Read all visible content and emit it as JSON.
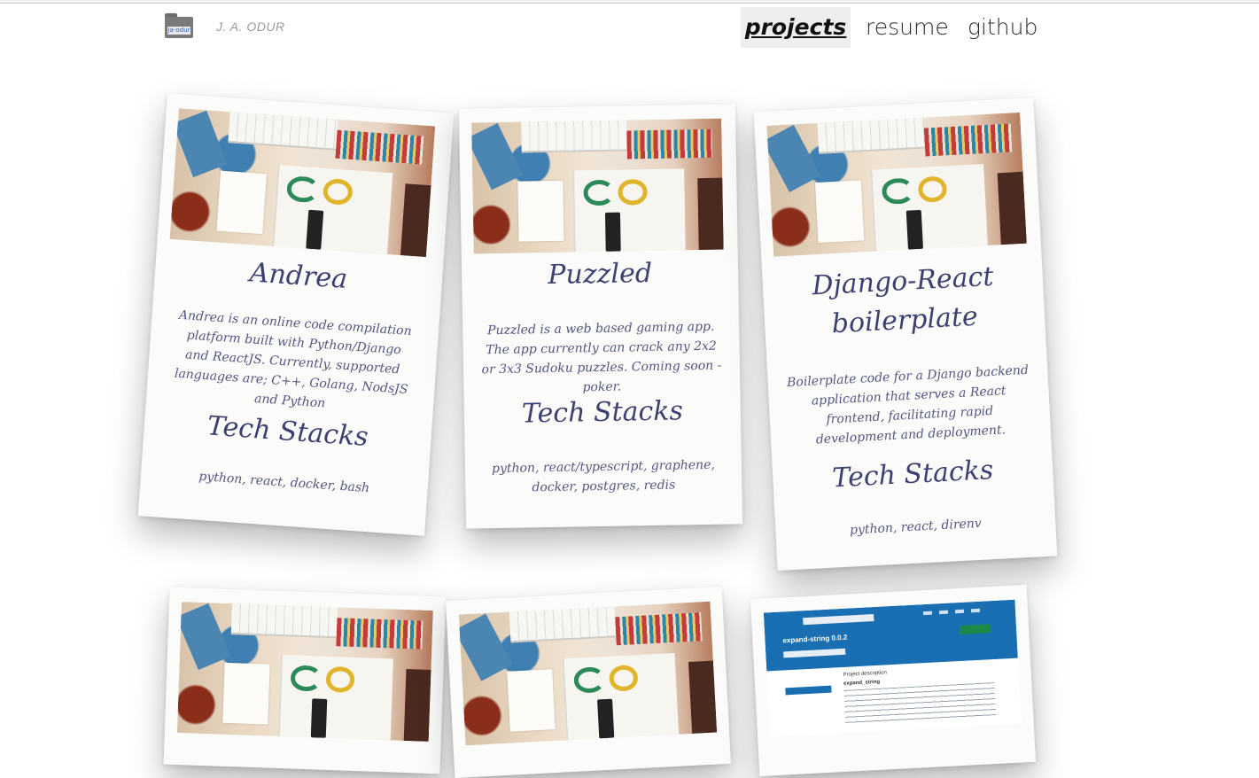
{
  "header": {
    "logo_label": "ja-odur",
    "brand": "J. A. ODUR",
    "nav": [
      {
        "label": "projects",
        "active": true
      },
      {
        "label": "resume",
        "active": false
      },
      {
        "label": "github",
        "active": false
      }
    ]
  },
  "cards": [
    {
      "title": "Andrea",
      "description": "Andrea is an online code compilation platform built with Python/Django and ReactJS. Currently, supported languages are; C++, Golang, NodsJS and Python",
      "tech_heading": "Tech Stacks",
      "stack": "python, react, docker, bash"
    },
    {
      "title": "Puzzled",
      "description": "Puzzled is a web based gaming app. The app currently can crack any 2x2 or 3x3 Sudoku puzzles. Coming soon - poker.",
      "tech_heading": "Tech Stacks",
      "stack": "python, react/typescript, graphene, docker, postgres, redis"
    },
    {
      "title": "Django-React boilerplate",
      "description": "Boilerplate code for a Django backend application that serves a React frontend, facilitating rapid development and deployment.",
      "tech_heading": "Tech Stacks",
      "stack": "python, react, direnv"
    },
    {
      "title": ""
    },
    {
      "title": ""
    },
    {
      "title": "",
      "screenshot_package": "expand-string 0.0.2",
      "screenshot_heading": "Project description",
      "screenshot_subheading": "expand_string"
    }
  ]
}
